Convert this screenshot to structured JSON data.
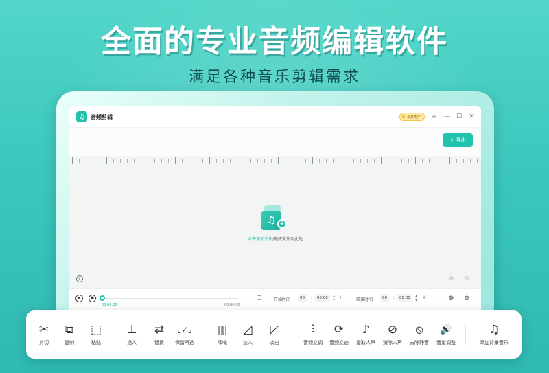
{
  "headline": "全面的专业音频编辑软件",
  "subline": "满足各种音乐剪辑需求",
  "app": {
    "icon_name": "music-note-icon",
    "name": "音频剪辑",
    "vip_label": "会员用户",
    "window_controls": [
      "≡",
      "—",
      "☐",
      "✕"
    ]
  },
  "export": {
    "label": "导出",
    "icon": "upload-icon"
  },
  "editor": {
    "drop_link": "点击添加文件",
    "drop_rest": "/拖拽文件到此处"
  },
  "playback": {
    "current_time": "00:00:00",
    "total_time": "00:00:00",
    "progress": 0,
    "start_label": "开始时间",
    "end_label": "结束时间",
    "start_min": "00",
    "start_sec": "00.00",
    "end_min": "00",
    "end_sec": "00.00"
  },
  "toolbar": {
    "items": [
      {
        "label": "剪切",
        "icon": "✂",
        "name": "cut"
      },
      {
        "label": "复制",
        "icon": "⧉",
        "name": "copy"
      },
      {
        "label": "粘贴",
        "icon": "⬚",
        "name": "paste"
      },
      {
        "label": "插入",
        "icon": "⊥",
        "name": "insert"
      },
      {
        "label": "替换",
        "icon": "⇄",
        "name": "replace"
      },
      {
        "label": "保留所选",
        "icon": "⌞✓⌟",
        "name": "keep-selected"
      },
      {
        "label": "降噪",
        "icon": "|‖|",
        "name": "denoise"
      },
      {
        "label": "淡入",
        "icon": "◿",
        "name": "fade-in"
      },
      {
        "label": "淡出",
        "icon": "◸",
        "name": "fade-out"
      },
      {
        "label": "音频变调",
        "icon": "⫶",
        "name": "pitch-shift"
      },
      {
        "label": "音频变速",
        "icon": "⟳",
        "name": "speed-change"
      },
      {
        "label": "提取人声",
        "icon": "♪",
        "name": "extract-vocal"
      },
      {
        "label": "消除人声",
        "icon": "⊘",
        "name": "remove-vocal"
      },
      {
        "label": "去除静音",
        "icon": "⦸",
        "name": "remove-silence"
      },
      {
        "label": "音量调整",
        "icon": "🔊",
        "name": "volume-adjust"
      },
      {
        "label": "添加背景音乐",
        "icon": "♫",
        "name": "add-bgm"
      }
    ]
  },
  "colors": {
    "accent": "#22c3ad",
    "background": "#3cc7bd"
  }
}
